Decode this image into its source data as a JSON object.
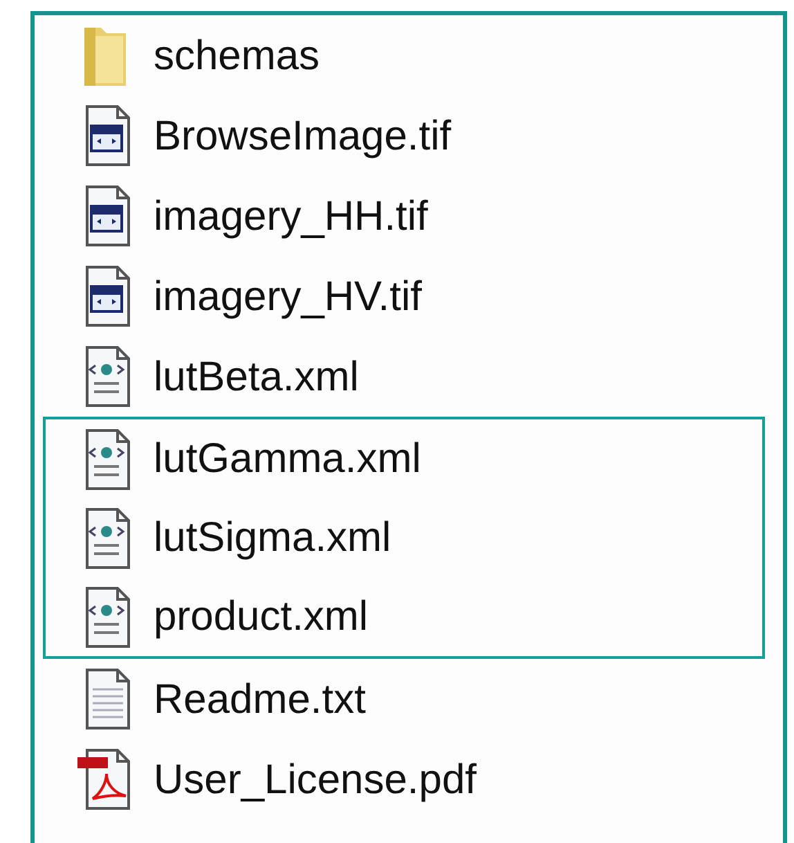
{
  "files": [
    {
      "kind": "folder",
      "name": "schemas",
      "highlighted": false
    },
    {
      "kind": "image",
      "name": "BrowseImage.tif",
      "highlighted": false
    },
    {
      "kind": "image",
      "name": "imagery_HH.tif",
      "highlighted": false
    },
    {
      "kind": "image",
      "name": "imagery_HV.tif",
      "highlighted": false
    },
    {
      "kind": "xml",
      "name": "lutBeta.xml",
      "highlighted": false
    },
    {
      "kind": "xml",
      "name": "lutGamma.xml",
      "highlighted": true
    },
    {
      "kind": "xml",
      "name": "lutSigma.xml",
      "highlighted": true
    },
    {
      "kind": "xml",
      "name": "product.xml",
      "highlighted": true
    },
    {
      "kind": "text",
      "name": "Readme.txt",
      "highlighted": false
    },
    {
      "kind": "pdf",
      "name": "User_License.pdf",
      "highlighted": false
    }
  ]
}
